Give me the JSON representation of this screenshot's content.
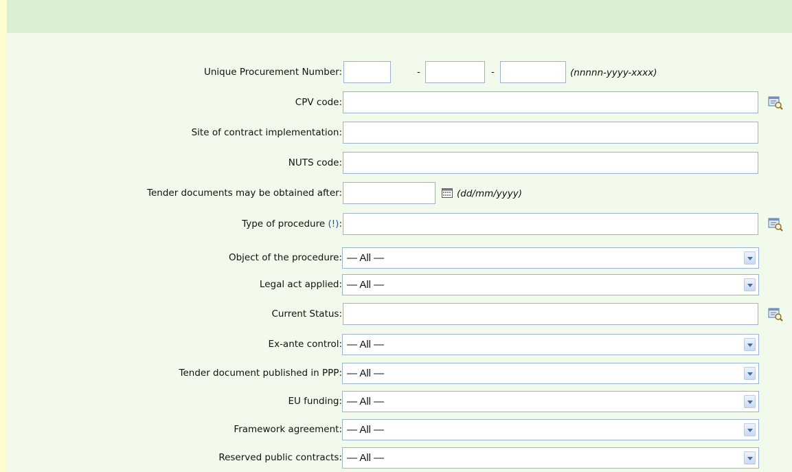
{
  "form": {
    "upn": {
      "label": "Unique Procurement Number:",
      "sep1": "-",
      "sep2": "-",
      "format_hint": "(nnnnn-yyyy-xxxx)",
      "part1": "",
      "part2": "",
      "part3": ""
    },
    "cpv": {
      "label": "CPV code:",
      "value": "",
      "icon": "lookup-icon"
    },
    "site": {
      "label": "Site of contract implementation:",
      "value": ""
    },
    "nuts": {
      "label": "NUTS code:",
      "value": ""
    },
    "tender_docs_after": {
      "label": "Tender documents may be obtained after:",
      "value": "",
      "format_hint": "(dd/mm/yyyy)",
      "icon": "calendar-icon"
    },
    "procedure_type": {
      "label": "Type of procedure",
      "hint": "(!)",
      "colon": ":",
      "value": "",
      "icon": "lookup-icon"
    },
    "object": {
      "label": "Object of the procedure:",
      "selected": "— All —"
    },
    "legal_act": {
      "label": "Legal act applied:",
      "selected": "— All —"
    },
    "status": {
      "label": "Current Status:",
      "value": "",
      "icon": "lookup-icon"
    },
    "ex_ante": {
      "label": "Ex-ante control:",
      "selected": "— All —"
    },
    "ppp": {
      "label": "Tender document published in PPP:",
      "selected": "— All —"
    },
    "eu_funding": {
      "label": "EU funding:",
      "selected": "— All —"
    },
    "framework": {
      "label": "Framework agreement:",
      "selected": "— All —"
    },
    "reserved": {
      "label": "Reserved public contracts:",
      "selected": "— All —"
    }
  },
  "colors": {
    "page_bg": "#fffcd0",
    "panel_bg": "#f1faeb",
    "header_bg": "#d8efd3",
    "border": "#9bb1cf",
    "hint_link": "#1b4fb0"
  }
}
